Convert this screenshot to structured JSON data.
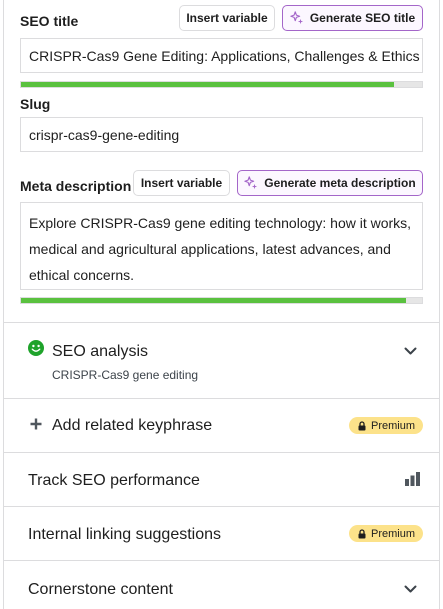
{
  "seo_title": {
    "label": "SEO title",
    "insert_variable_label": "Insert variable",
    "generate_label": "Generate SEO title",
    "value": "CRISPR-Cas9 Gene Editing: Applications, Challenges & Ethics",
    "progress": 0.93
  },
  "slug": {
    "label": "Slug",
    "value": "crispr-cas9-gene-editing"
  },
  "meta_description": {
    "label": "Meta description",
    "insert_variable_label": "Insert variable",
    "generate_label": "Generate meta description",
    "value": "Explore CRISPR-Cas9 gene editing technology: how it works, medical and agricultural applications, latest advances, and ethical concerns.",
    "progress": 0.96
  },
  "sections": {
    "seo_analysis": {
      "title": "SEO analysis",
      "subtitle": "CRISPR-Cas9 gene editing",
      "status_icon": "smiley-good-icon",
      "status_color": "#1fa32b"
    },
    "related_keyphrase": {
      "title": "Add related keyphrase",
      "badge": "Premium",
      "icon": "plus-icon"
    },
    "track_performance": {
      "title": "Track SEO performance",
      "icon": "bar-chart-icon"
    },
    "internal_linking": {
      "title": "Internal linking suggestions",
      "badge": "Premium"
    },
    "cornerstone": {
      "title": "Cornerstone content"
    }
  },
  "colors": {
    "progress_good": "#5ac13f",
    "ai_border": "#a466c9",
    "premium_bg": "#fce28a",
    "border": "#dcdcde"
  }
}
